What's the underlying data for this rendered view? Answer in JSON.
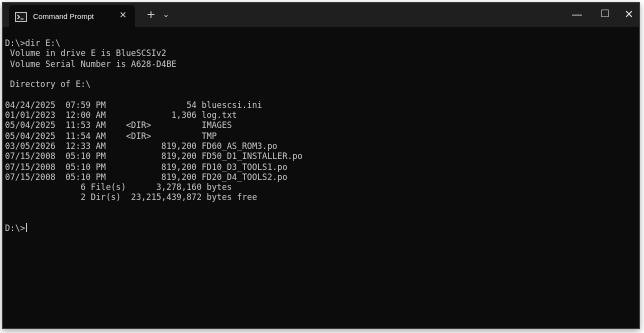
{
  "tab": {
    "title": "Command Prompt",
    "close_glyph": "✕"
  },
  "toolbar": {
    "new_tab_glyph": "+",
    "menu_glyph": "⌄"
  },
  "window_controls": {
    "minimize_glyph": "—",
    "maximize_glyph": "☐",
    "close_glyph": "✕"
  },
  "icons": {
    "tab_icon": "terminal-icon"
  },
  "colors": {
    "background": "#0c0c0c",
    "text": "#cccccc",
    "titlebar": "#1f1f1f"
  },
  "terminal": {
    "lines": [
      "D:\\>dir E:\\",
      " Volume in drive E is BlueSCSIv2",
      " Volume Serial Number is A628-D4BE",
      "",
      " Directory of E:\\",
      "",
      "04/24/2025  07:59 PM                54 bluescsi.ini",
      "01/01/2023  12:00 AM             1,306 log.txt",
      "05/04/2025  11:53 AM    <DIR>          IMAGES",
      "05/04/2025  11:54 AM    <DIR>          TMP",
      "03/05/2026  12:33 AM           819,200 FD60_AS_ROM3.po",
      "07/15/2008  05:10 PM           819,200 FD50_D1_INSTALLER.po",
      "07/15/2008  05:10 PM           819,200 FD10_D3_TOOLS1.po",
      "07/15/2008  05:10 PM           819,200 FD20_D4_TOOLS2.po",
      "               6 File(s)      3,278,160 bytes",
      "               2 Dir(s)  23,215,439,872 bytes free",
      "",
      ""
    ],
    "prompt": "D:\\>"
  }
}
